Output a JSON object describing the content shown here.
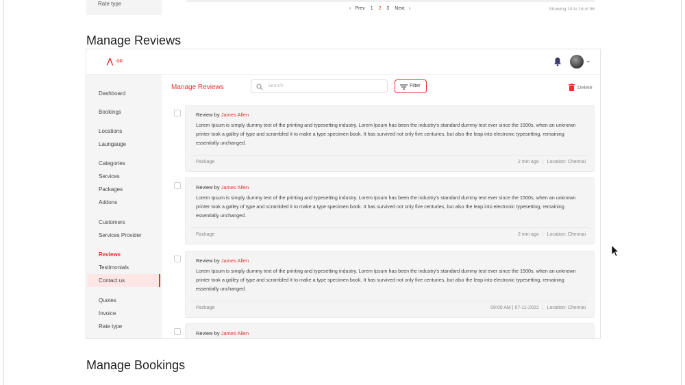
{
  "top_remnant": {
    "sidebar_label": "Rate type",
    "pagination": {
      "prev": "Prev",
      "pages": [
        "1",
        "2",
        "3"
      ],
      "active_page": "2",
      "next": "Next"
    },
    "showing_text": "Showing 10 to 16 of 56"
  },
  "section_titles": {
    "reviews": "Manage Reviews",
    "bookings": "Manage Bookings"
  },
  "app": {
    "logo_text": "OD",
    "sidebar": {
      "items": [
        "Dashboard",
        "Bookings",
        "Locations",
        "Laungauge",
        "Categories",
        "Services",
        "Packages",
        "Addons",
        "Customers",
        "Services Provider",
        "Reviews",
        "Testimonials",
        "Contact us",
        "Quotes",
        "Invoice",
        "Rate type"
      ],
      "active": "Reviews"
    },
    "content": {
      "title": "Manage Reviews",
      "search_placeholder": "Search",
      "filter_label": "Filter",
      "delete_label": "Delete",
      "reviews": [
        {
          "by_prefix": "Review by",
          "author": "James Allen",
          "text": "Lorem Ipsum is simply dummy text of the printing and typesetting industry. Lorem Ipsum has been the industry's standard dummy text ever since the 1500s, when an unknown printer took a galley of type and scrambled it to make a type specimen book. It has survived not only five centuries, but also the leap into electronic typesetting, remaining essentially unchanged.",
          "type": "Package",
          "time": "2 min ago",
          "location": "Location: Chennai"
        },
        {
          "by_prefix": "Review by",
          "author": "James Allen",
          "text": "Lorem Ipsum is simply dummy text of the printing and typesetting industry. Lorem Ipsum has been the industry's standard dummy text ever since the 1500s, when an unknown printer took a galley of type and scrambled it to make a type specimen book. It has survived not only five centuries, but also the leap into electronic typesetting, remaining essentially unchanged.",
          "type": "Package",
          "time": "2 min ago",
          "location": "Location: Chennai"
        },
        {
          "by_prefix": "Review by",
          "author": "James Allen",
          "text": "Lorem Ipsum is simply dummy text of the printing and typesetting industry. Lorem Ipsum has been the industry's standard dummy text ever since the 1500s, when an unknown printer took a galley of type and scrambled it to make a type specimen book. It has survived not only five centuries, but also the leap into electronic typesetting, remaining essentially unchanged.",
          "type": "Package",
          "time": "09:00 AM | 07-11-2022",
          "location": "Location: Chennai"
        },
        {
          "by_prefix": "Review by",
          "author": "James Allen"
        }
      ]
    }
  },
  "colors": {
    "accent": "#e8302f",
    "sidebar_bg": "#f5f5f5",
    "card_bg": "#f4f4f4"
  },
  "icons": [
    "search-icon",
    "filter-icon",
    "trash-icon",
    "bell-icon",
    "chevron-down-icon",
    "mouse-cursor-icon"
  ]
}
